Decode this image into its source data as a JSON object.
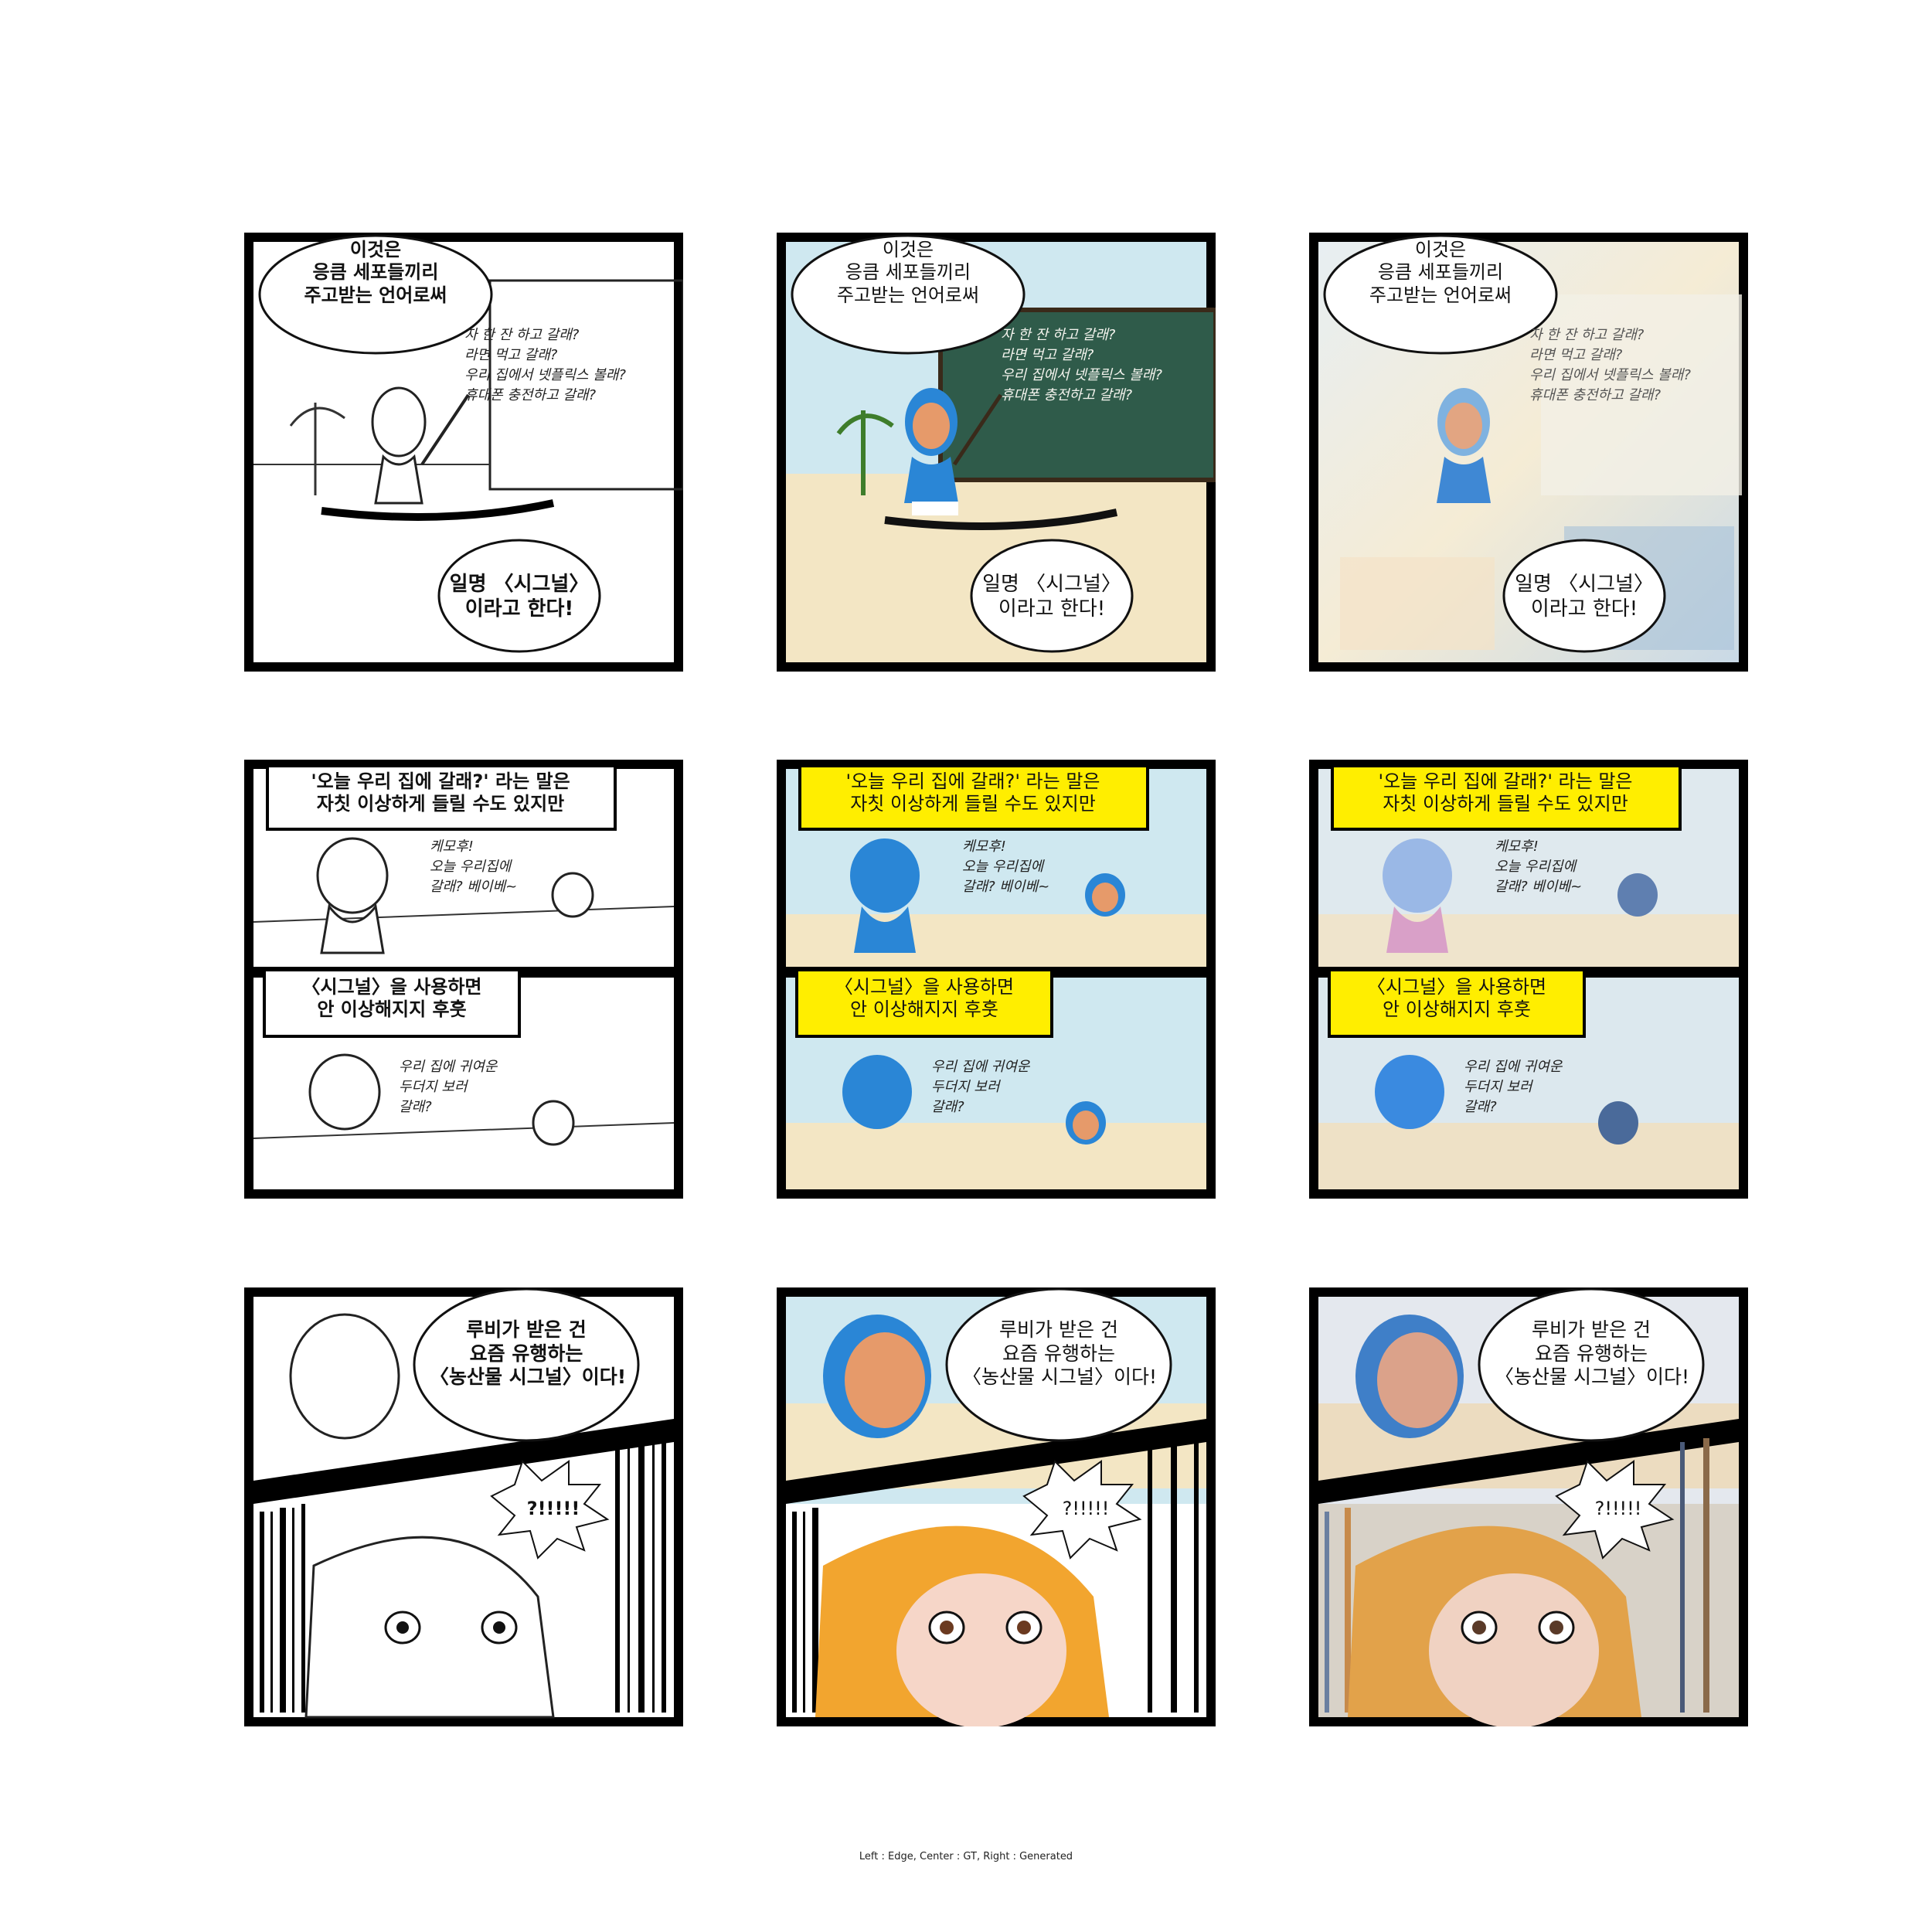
{
  "panels": {
    "p1": {
      "bubble_top": [
        "이것은",
        "응큼 세포들끼리",
        "주고받는 언어로써"
      ],
      "board": [
        "자 한 잔 하고 갈래?",
        "라면 먹고 갈래?",
        "우리 집에서 넷플릭스 볼래?",
        "휴대폰 충전하고 갈래?"
      ],
      "bubble_bottom": [
        "일명 〈시그널〉",
        "이라고 한다!"
      ]
    },
    "p2": {
      "caption_top": [
        "'오늘 우리 집에 갈래?' 라는 말은",
        "자칫 이상하게 들릴 수도 있지만"
      ],
      "speech_top": [
        "케모후!",
        "오늘 우리집에",
        "갈래? 베이베~"
      ],
      "caption_mid": [
        "〈시그널〉을 사용하면",
        "안 이상해지지 후훗"
      ],
      "speech_bottom": [
        "우리 집에 귀여운",
        "두더지 보러",
        "갈래?"
      ]
    },
    "p3": {
      "bubble": [
        "루비가 받은 건",
        "요즘 유행하는",
        "〈농산물 시그널〉이다!"
      ],
      "burst": "?!!!!!"
    }
  },
  "footer_caption": "Left : Edge, Center : GT, Right : Generated",
  "colors": {
    "frame": "#000000",
    "caption_yellow": "#ffee00",
    "sky": "#cfe8f0",
    "sand": "#f3e6c4",
    "board": "#2f5b4a",
    "hood": "#2a86d6",
    "skin": "#e69a6a",
    "hair": "#f2a52f"
  }
}
